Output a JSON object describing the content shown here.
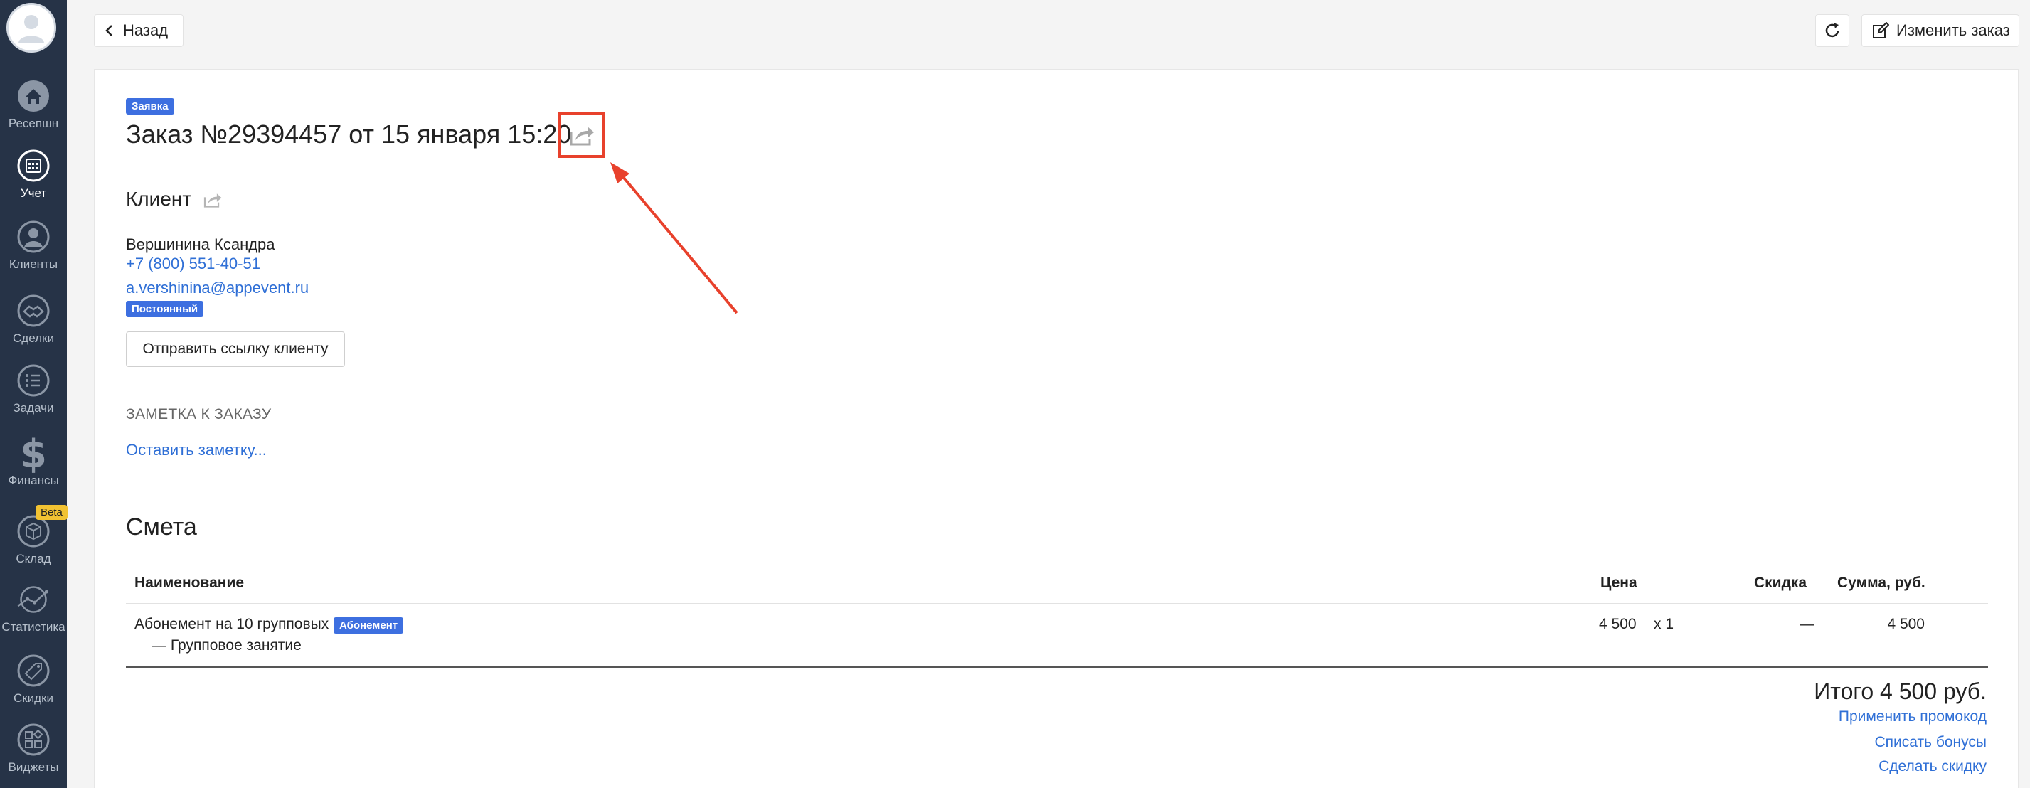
{
  "sidebar": {
    "items": [
      {
        "label": "Ресепшн",
        "icon": "home-icon"
      },
      {
        "label": "Учет",
        "icon": "calendar-icon",
        "active": true
      },
      {
        "label": "Клиенты",
        "icon": "user-icon"
      },
      {
        "label": "Сделки",
        "icon": "handshake-icon"
      },
      {
        "label": "Задачи",
        "icon": "checklist-icon"
      },
      {
        "label": "Финансы",
        "icon": "dollar-icon"
      },
      {
        "label": "Склад",
        "icon": "box-icon",
        "badge": "Beta"
      },
      {
        "label": "Статистика",
        "icon": "chart-icon"
      },
      {
        "label": "Скидки",
        "icon": "tag-icon"
      },
      {
        "label": "Виджеты",
        "icon": "widgets-icon"
      }
    ]
  },
  "toolbar": {
    "back_label": "Назад",
    "edit_label": "Изменить заказ"
  },
  "order": {
    "type_badge": "Заявка",
    "title": "Заказ №29394457 от 15 января 15:20"
  },
  "client": {
    "section_title": "Клиент",
    "name": "Вершинина Ксандра",
    "phone": "+7 (800) 551-40-51",
    "email": "a.vershinina@appevent.ru",
    "status_badge": "Постоянный",
    "send_link_label": "Отправить ссылку клиенту"
  },
  "note": {
    "header": "ЗАМЕТКА К ЗАКАЗУ",
    "add_link": "Оставить заметку..."
  },
  "estimate": {
    "title": "Смета",
    "columns": {
      "name": "Наименование",
      "price": "Цена",
      "discount": "Скидка",
      "sum": "Сумма, руб."
    },
    "rows": [
      {
        "name": "Абонемент на 10 групповых",
        "badge": "Абонемент",
        "subname": "— Групповое занятие",
        "price": "4 500",
        "qty": "x 1",
        "discount": "—",
        "sum": "4 500"
      }
    ],
    "total": "Итого 4 500 руб.",
    "apply_promo": "Применить промокод",
    "write_off_bonus": "Списать бонусы",
    "make_discount": "Сделать скидку"
  },
  "colors": {
    "sidebar_bg": "#263347",
    "accent": "#3d6fe0",
    "link": "#2f6fd6",
    "highlight": "#e8412c"
  }
}
